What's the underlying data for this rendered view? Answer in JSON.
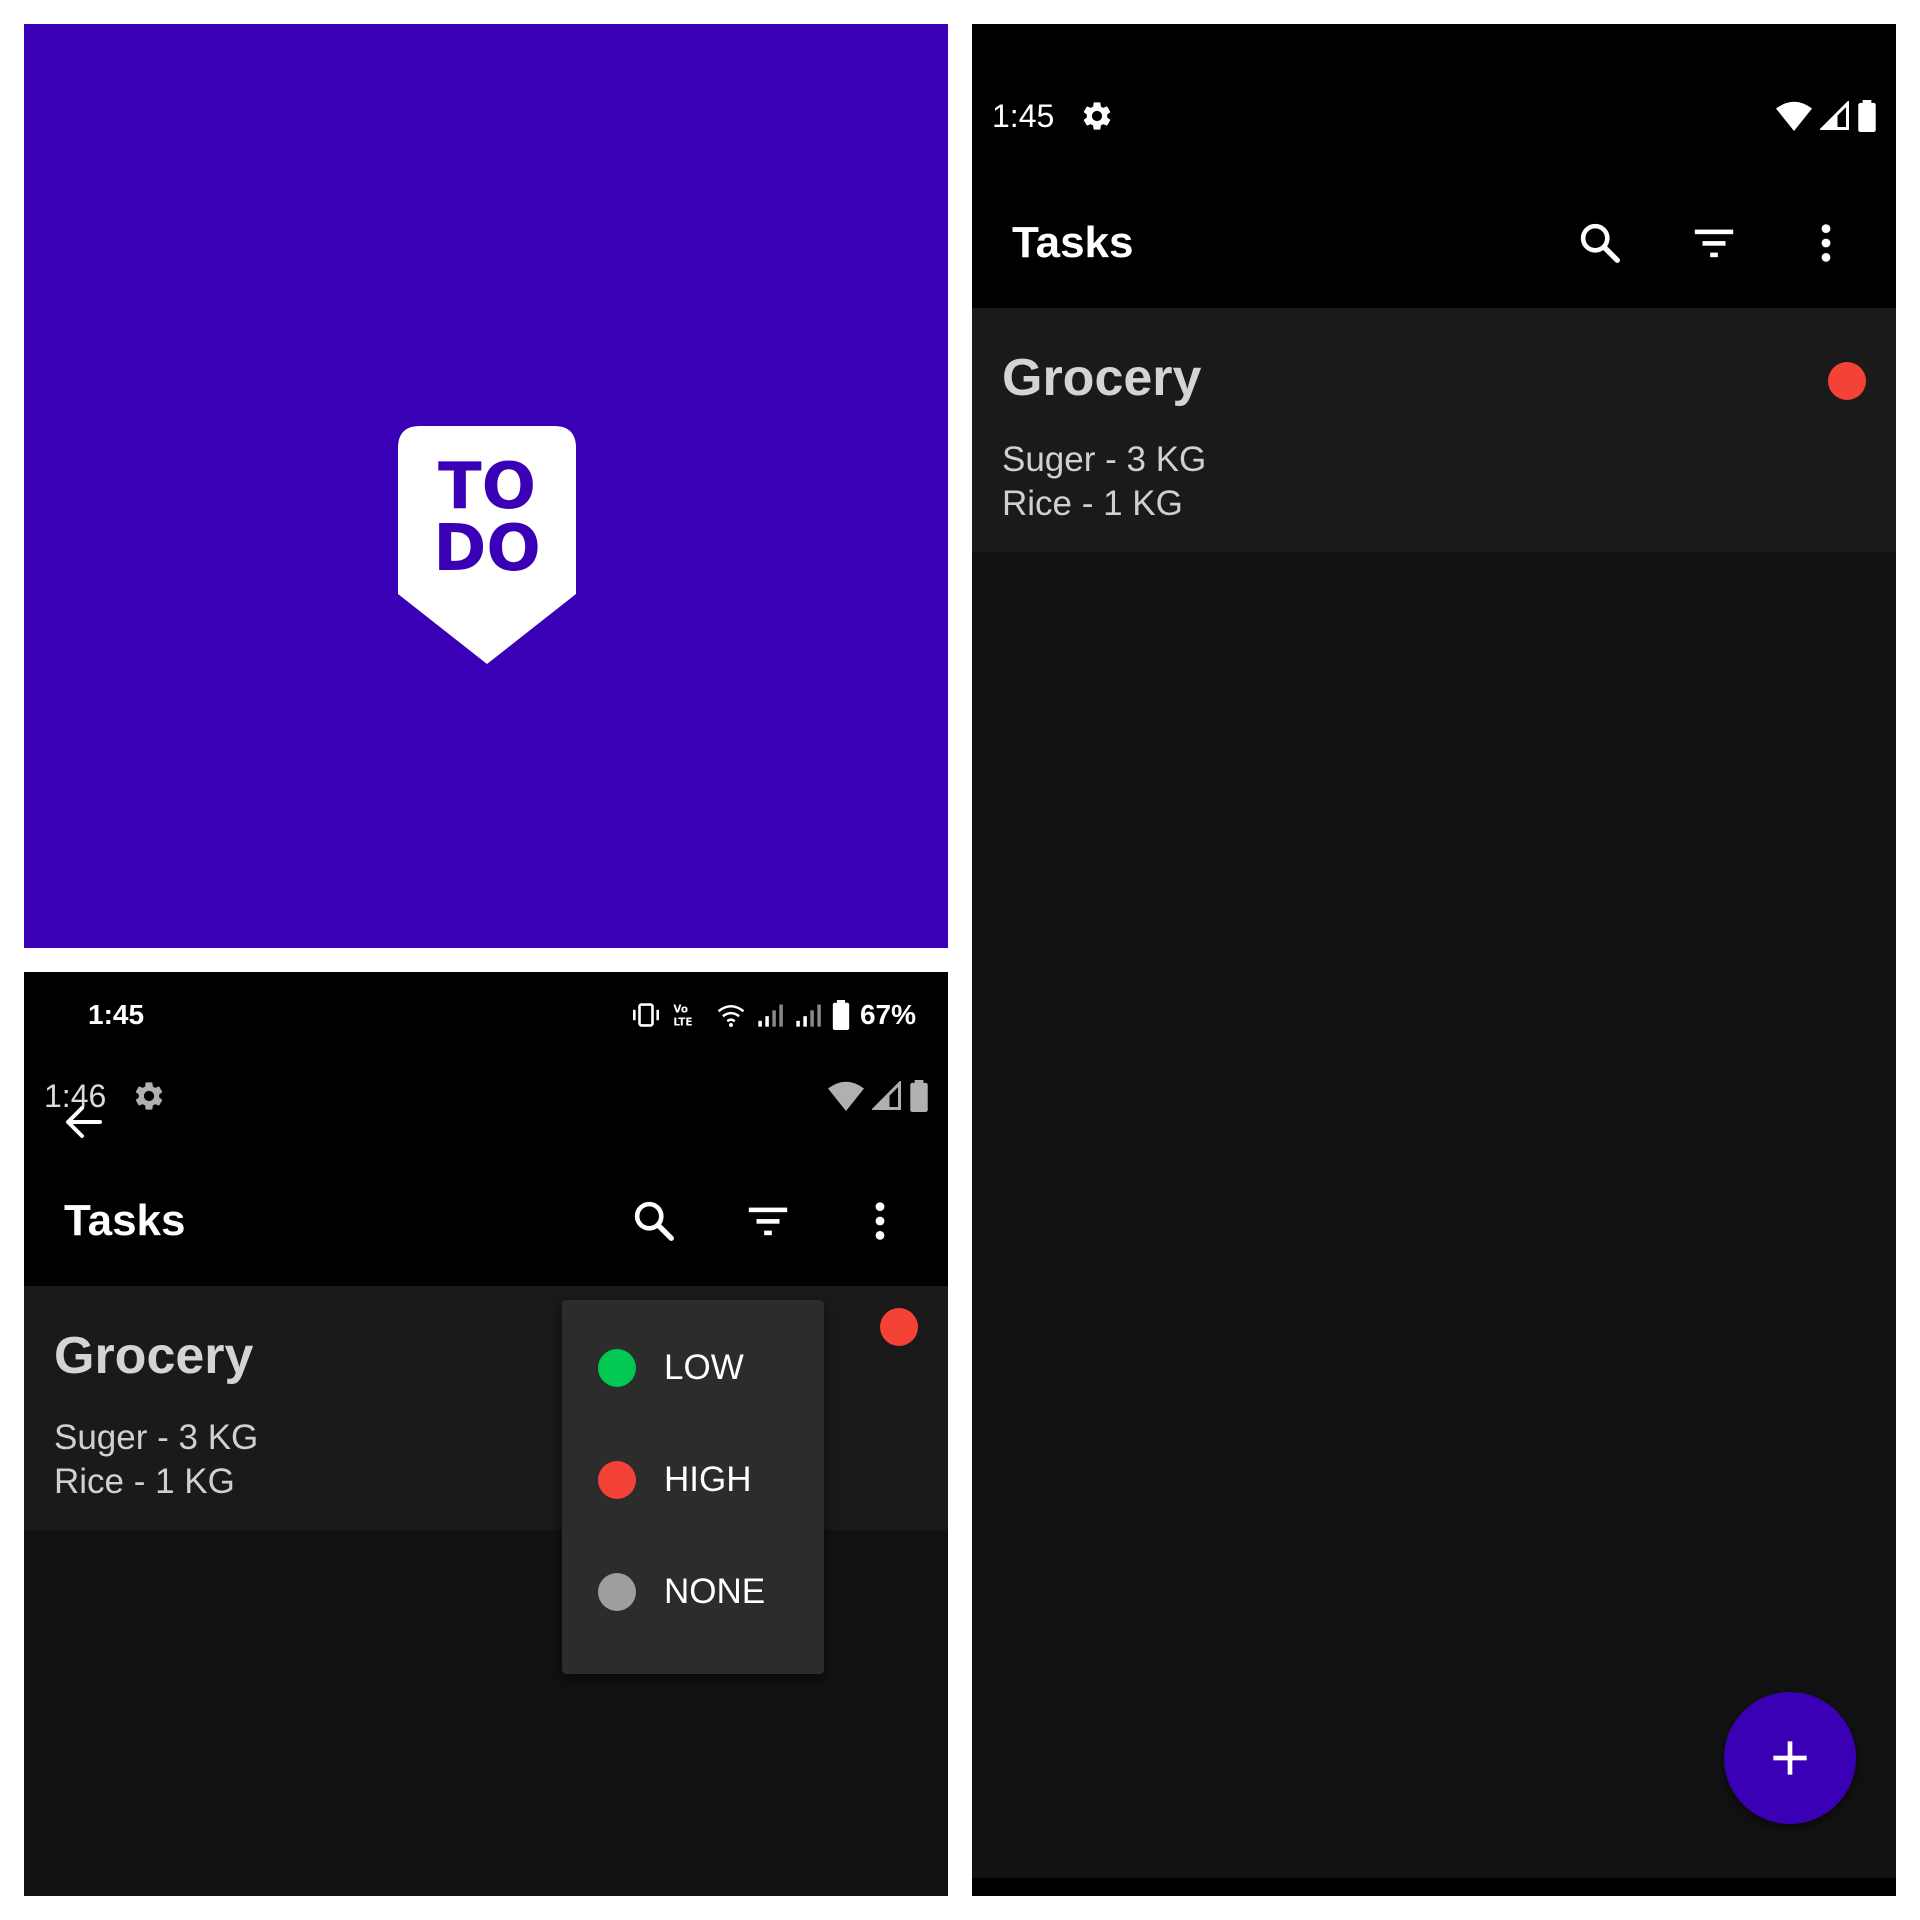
{
  "splash": {
    "background_color": "#3a00b6",
    "logo": {
      "line1": "TO",
      "line2": "DO",
      "badge_color": "#ffffff",
      "text_color": "#3a00b6"
    }
  },
  "main_screen": {
    "status_bar": {
      "time": "1:45",
      "icons": [
        "gear-icon",
        "wifi-icon",
        "cell-signal-icon",
        "battery-icon"
      ]
    },
    "app_bar": {
      "title": "Tasks",
      "actions": [
        "search-icon",
        "filter-icon",
        "more-vert-icon"
      ]
    },
    "tasks": [
      {
        "title": "Grocery",
        "lines": [
          "Suger - 3 KG",
          "Rice - 1 KG"
        ],
        "priority": "HIGH",
        "priority_color": "#f44336"
      }
    ],
    "fab": {
      "icon": "plus-icon",
      "color": "#3a00b6"
    }
  },
  "filter_screen": {
    "device_status_bar": {
      "time": "1:45",
      "battery_percent": "67%",
      "icons": [
        "vibrate-icon",
        "volte-icon",
        "wifi-icon",
        "cell-signal-icon",
        "cell-signal-icon",
        "battery-icon"
      ]
    },
    "status_bar": {
      "time": "1:46",
      "icons": [
        "gear-icon",
        "wifi-icon",
        "cell-signal-icon",
        "battery-icon"
      ]
    },
    "back_icon": "back-arrow-icon",
    "app_bar": {
      "title": "Tasks",
      "actions": [
        "search-icon",
        "filter-icon",
        "more-vert-icon"
      ]
    },
    "tasks": [
      {
        "title": "Grocery",
        "lines": [
          "Suger - 3 KG",
          "Rice - 1 KG"
        ],
        "priority": "HIGH",
        "priority_color": "#f44336"
      }
    ],
    "filter_menu": {
      "items": [
        {
          "label": "LOW",
          "color": "#00c853"
        },
        {
          "label": "HIGH",
          "color": "#f44336"
        },
        {
          "label": "NONE",
          "color": "#9e9e9e"
        }
      ]
    }
  }
}
